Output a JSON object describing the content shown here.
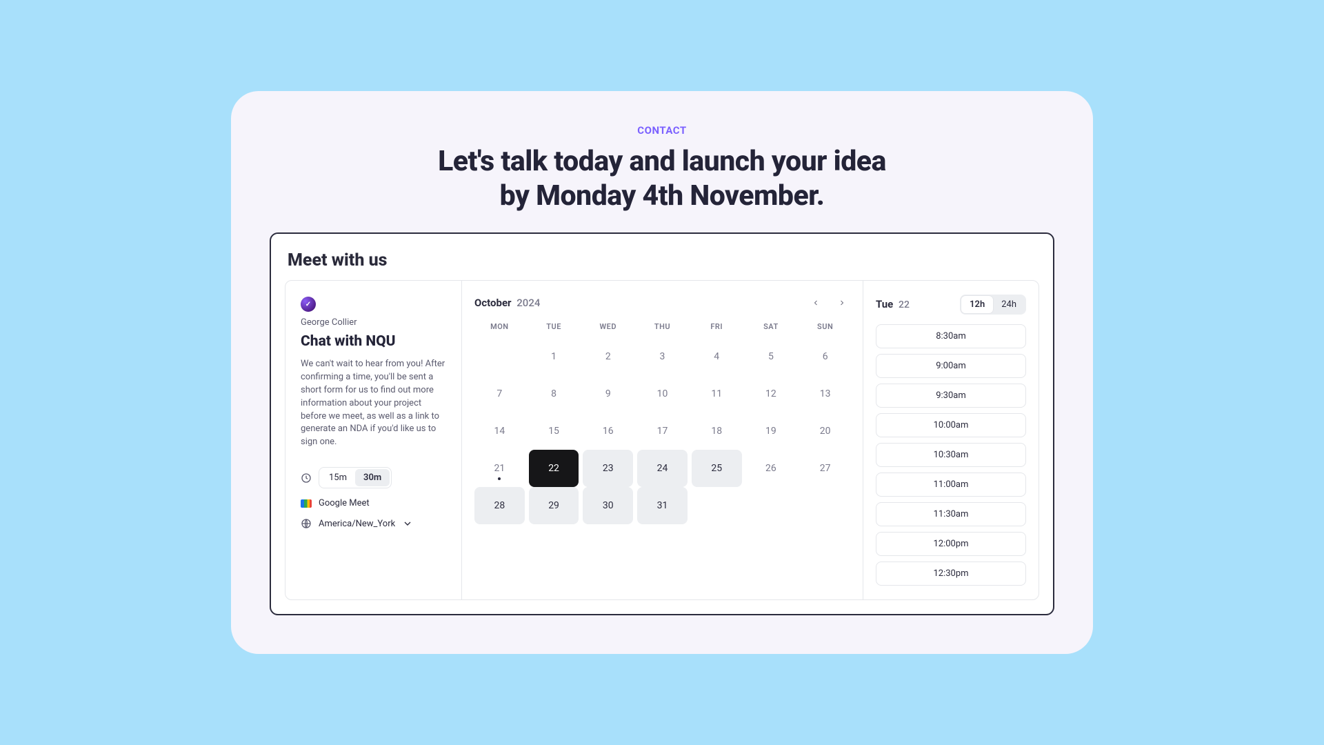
{
  "eyebrow": "CONTACT",
  "headline_l1": "Let's talk today and launch your idea",
  "headline_l2": "by Monday 4th November.",
  "panel_title": "Meet with us",
  "host": {
    "name": "George Collier",
    "event_title": "Chat with NQU",
    "description": "We can't wait to hear from you! After confirming a time, you'll be sent a short form for us to find out more information about your project before we meet, as well as a link to generate an NDA if you'd like us to sign one."
  },
  "duration": {
    "options": [
      "15m",
      "30m"
    ],
    "selected": "30m"
  },
  "location_label": "Google Meet",
  "timezone_label": "America/New_York",
  "calendar": {
    "month": "October",
    "year": "2024",
    "dow": [
      "MON",
      "TUE",
      "WED",
      "THU",
      "FRI",
      "SAT",
      "SUN"
    ],
    "weeks": [
      [
        {
          "n": ""
        },
        {
          "n": "1"
        },
        {
          "n": "2"
        },
        {
          "n": "3"
        },
        {
          "n": "4"
        },
        {
          "n": "5"
        },
        {
          "n": "6"
        }
      ],
      [
        {
          "n": "7"
        },
        {
          "n": "8"
        },
        {
          "n": "9"
        },
        {
          "n": "10"
        },
        {
          "n": "11"
        },
        {
          "n": "12"
        },
        {
          "n": "13"
        }
      ],
      [
        {
          "n": "14"
        },
        {
          "n": "15"
        },
        {
          "n": "16"
        },
        {
          "n": "17"
        },
        {
          "n": "18"
        },
        {
          "n": "19"
        },
        {
          "n": "20"
        }
      ],
      [
        {
          "n": "21",
          "today": true
        },
        {
          "n": "22",
          "selected": true
        },
        {
          "n": "23",
          "avail": true
        },
        {
          "n": "24",
          "avail": true
        },
        {
          "n": "25",
          "avail": true
        },
        {
          "n": "26"
        },
        {
          "n": "27"
        }
      ],
      [
        {
          "n": "28",
          "avail": true
        },
        {
          "n": "29",
          "avail": true
        },
        {
          "n": "30",
          "avail": true
        },
        {
          "n": "31",
          "avail": true
        },
        {
          "n": ""
        },
        {
          "n": ""
        },
        {
          "n": ""
        }
      ]
    ]
  },
  "selected_day": {
    "dow": "Tue",
    "num": "22"
  },
  "time_format": {
    "options": [
      "12h",
      "24h"
    ],
    "selected": "12h"
  },
  "slots": [
    "8:30am",
    "9:00am",
    "9:30am",
    "10:00am",
    "10:30am",
    "11:00am",
    "11:30am",
    "12:00pm",
    "12:30pm"
  ]
}
